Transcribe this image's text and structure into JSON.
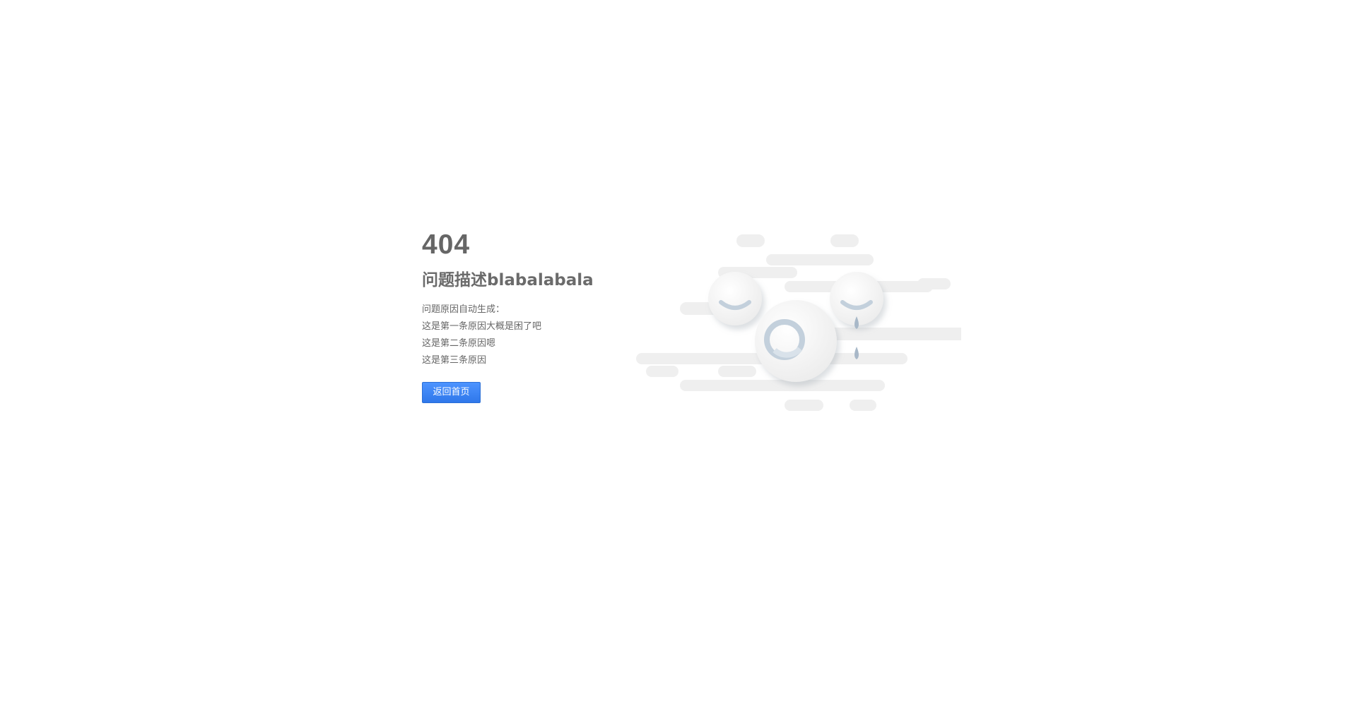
{
  "error": {
    "code": "404",
    "title": "问题描述blabalabala",
    "reasons_heading": "问题原因自动生成：",
    "reasons": [
      "这是第一条原因大概是困了吧",
      "这是第二条原因嗯",
      "这是第三条原因"
    ]
  },
  "actions": {
    "home_label": "返回首页"
  },
  "illustration": {
    "icon": "crying-face-illustration",
    "colors": {
      "cloud": "#f0f0f0",
      "face": "#f7f7f7",
      "feature": "#c3d0dc",
      "tear": "#a8b8c8",
      "button_blue": "#3a82f0"
    }
  }
}
